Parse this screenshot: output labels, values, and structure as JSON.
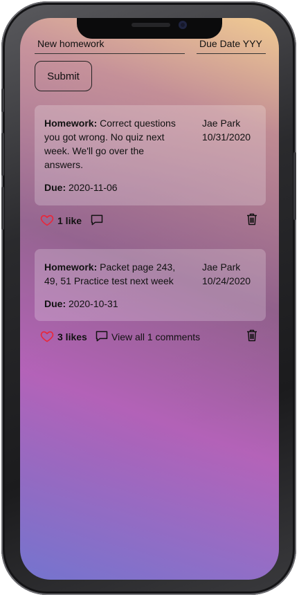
{
  "form": {
    "homework_placeholder": "New homework",
    "due_placeholder": "Due Date YYY",
    "submit_label": "Submit"
  },
  "posts": [
    {
      "label": "Homework:",
      "text": "Correct questions you got wrong. No quiz next week. We'll go over the answers.",
      "author": "Jae Park",
      "date": "10/31/2020",
      "due_label": "Due:",
      "due": "2020-11-06",
      "likes": "1 like",
      "comments_link": ""
    },
    {
      "label": "Homework:",
      "text": "Packet page 243, 49, 51 Practice test next week",
      "author": "Jae Park",
      "date": "10/24/2020",
      "due_label": "Due:",
      "due": "2020-10-31",
      "likes": "3 likes",
      "comments_link": "View all 1 comments"
    }
  ],
  "colors": {
    "heart": "#e8283c",
    "text": "#111111"
  }
}
